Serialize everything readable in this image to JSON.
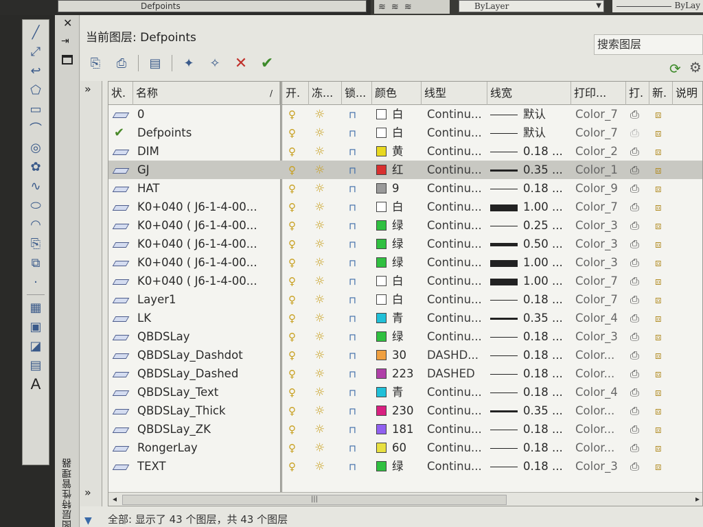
{
  "top": {
    "prev_layer": "Defpoints",
    "linetype_combo": "ByLayer",
    "lineweight_combo": "ByLay"
  },
  "palette": {
    "title_vertical": "图层特性管理器",
    "current_layer_label": "当前图层: Defpoints",
    "search_placeholder": "搜索图层",
    "status_text": "全部: 显示了 43 个图层，共 43 个图层"
  },
  "columns": {
    "status": "状.",
    "name": "名称",
    "on": "开.",
    "freeze": "冻...",
    "lock": "锁...",
    "color": "颜色",
    "linetype": "线型",
    "lineweight": "线宽",
    "plotstyle": "打印...",
    "plot": "打.",
    "newvp": "新.",
    "desc": "说明"
  },
  "icons": {
    "on": "lightbulb-icon",
    "freeze": "sun-icon",
    "lock": "unlock-icon",
    "plot": "printer-icon",
    "newvp": "new-viewport-freeze-icon"
  },
  "layers": [
    {
      "status": "layer",
      "name": "0",
      "color": "白",
      "color_hex": "#ffffff",
      "linetype": "Continu...",
      "lw": "默认",
      "lw_thick": 1,
      "plotstyle": "Color_7",
      "print_dim": false
    },
    {
      "status": "current",
      "name": "Defpoints",
      "color": "白",
      "color_hex": "#ffffff",
      "linetype": "Continu...",
      "lw": "默认",
      "lw_thick": 1,
      "plotstyle": "Color_7",
      "print_dim": true
    },
    {
      "status": "layer",
      "name": "DIM",
      "color": "黄",
      "color_hex": "#e8d820",
      "linetype": "Continu...",
      "lw": "0.18 ...",
      "lw_thick": 1,
      "plotstyle": "Color_2",
      "print_dim": false
    },
    {
      "status": "layer",
      "name": "GJ",
      "color": "红",
      "color_hex": "#d83030",
      "linetype": "Continu...",
      "lw": "0.35 ...",
      "lw_thick": 3,
      "plotstyle": "Color_1",
      "print_dim": false,
      "selected": true
    },
    {
      "status": "layer",
      "name": "HAT",
      "color": "9",
      "color_hex": "#9a9a9a",
      "linetype": "Continu...",
      "lw": "0.18 ...",
      "lw_thick": 1,
      "plotstyle": "Color_9",
      "print_dim": false
    },
    {
      "status": "layer",
      "name": "K0+040 ( J6-1-4-00...",
      "color": "白",
      "color_hex": "#ffffff",
      "linetype": "Continu...",
      "lw": "1.00 ...",
      "lw_thick": 10,
      "plotstyle": "Color_7",
      "print_dim": false
    },
    {
      "status": "layer",
      "name": "K0+040 ( J6-1-4-00...",
      "color": "绿",
      "color_hex": "#30c040",
      "linetype": "Continu...",
      "lw": "0.25 ...",
      "lw_thick": 1,
      "plotstyle": "Color_3",
      "print_dim": false
    },
    {
      "status": "layer",
      "name": "K0+040 ( J6-1-4-00...",
      "color": "绿",
      "color_hex": "#30c040",
      "linetype": "Continu...",
      "lw": "0.50 ...",
      "lw_thick": 5,
      "plotstyle": "Color_3",
      "print_dim": false
    },
    {
      "status": "layer",
      "name": "K0+040 ( J6-1-4-00...",
      "color": "绿",
      "color_hex": "#30c040",
      "linetype": "Continu...",
      "lw": "1.00 ...",
      "lw_thick": 10,
      "plotstyle": "Color_3",
      "print_dim": false
    },
    {
      "status": "layer",
      "name": "K0+040 ( J6-1-4-00...",
      "color": "白",
      "color_hex": "#ffffff",
      "linetype": "Continu...",
      "lw": "1.00 ...",
      "lw_thick": 10,
      "plotstyle": "Color_7",
      "print_dim": false
    },
    {
      "status": "layer",
      "name": "Layer1",
      "color": "白",
      "color_hex": "#ffffff",
      "linetype": "Continu...",
      "lw": "0.18 ...",
      "lw_thick": 1,
      "plotstyle": "Color_7",
      "print_dim": false
    },
    {
      "status": "layer",
      "name": "LK",
      "color": "青",
      "color_hex": "#20c0d8",
      "linetype": "Continu...",
      "lw": "0.35 ...",
      "lw_thick": 3,
      "plotstyle": "Color_4",
      "print_dim": false
    },
    {
      "status": "layer",
      "name": "QBDSLay",
      "color": "绿",
      "color_hex": "#30c040",
      "linetype": "Continu...",
      "lw": "0.18 ...",
      "lw_thick": 1,
      "plotstyle": "Color_3",
      "print_dim": false
    },
    {
      "status": "layer",
      "name": "QBDSLay_Dashdot",
      "color": "30",
      "color_hex": "#f0a040",
      "linetype": "DASHD...",
      "lw": "0.18 ...",
      "lw_thick": 1,
      "plotstyle": "Color...",
      "print_dim": false
    },
    {
      "status": "layer",
      "name": "QBDSLay_Dashed",
      "color": "223",
      "color_hex": "#b040a8",
      "linetype": "DASHED",
      "lw": "0.18 ...",
      "lw_thick": 1,
      "plotstyle": "Color...",
      "print_dim": false
    },
    {
      "status": "layer",
      "name": "QBDSLay_Text",
      "color": "青",
      "color_hex": "#20c0d8",
      "linetype": "Continu...",
      "lw": "0.18 ...",
      "lw_thick": 1,
      "plotstyle": "Color_4",
      "print_dim": false
    },
    {
      "status": "layer",
      "name": "QBDSLay_Thick",
      "color": "230",
      "color_hex": "#d82080",
      "linetype": "Continu...",
      "lw": "0.35 ...",
      "lw_thick": 3,
      "plotstyle": "Color...",
      "print_dim": false
    },
    {
      "status": "layer",
      "name": "QBDSLay_ZK",
      "color": "181",
      "color_hex": "#9060f0",
      "linetype": "Continu...",
      "lw": "0.18 ...",
      "lw_thick": 1,
      "plotstyle": "Color...",
      "print_dim": false
    },
    {
      "status": "layer",
      "name": "RongerLay",
      "color": "60",
      "color_hex": "#e8e040",
      "linetype": "Continu...",
      "lw": "0.18 ...",
      "lw_thick": 1,
      "plotstyle": "Color...",
      "print_dim": false
    },
    {
      "status": "layer",
      "name": "TEXT",
      "color": "绿",
      "color_hex": "#30c040",
      "linetype": "Continu...",
      "lw": "0.18 ...",
      "lw_thick": 1,
      "plotstyle": "Color_3",
      "print_dim": false
    }
  ]
}
